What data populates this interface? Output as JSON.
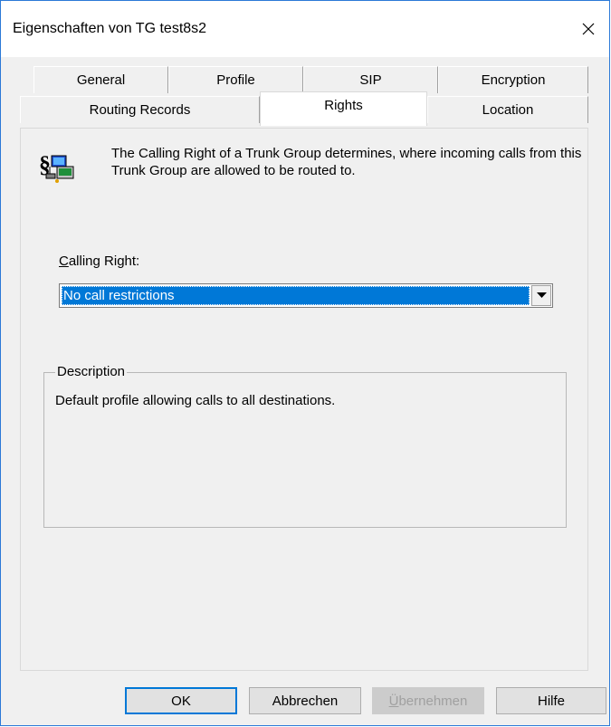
{
  "window": {
    "title": "Eigenschaften von TG test8s2",
    "close_glyph": "✕"
  },
  "tabs": {
    "row1": [
      "General",
      "Profile",
      "SIP",
      "Encryption"
    ],
    "row2": [
      "Routing Records",
      "Rights",
      "Location"
    ],
    "active": "Rights"
  },
  "rights": {
    "icon": "trunk-group-rights-icon",
    "info_text": "The Calling Right of a Trunk Group determines, where incoming calls from this Trunk Group are allowed to be routed to.",
    "calling_right_label_accel": "C",
    "calling_right_label_rest": "alling Right:",
    "calling_right_value": "No call restrictions",
    "description_title": "Description",
    "description_text": "Default profile allowing calls to all destinations."
  },
  "buttons": {
    "ok": "OK",
    "cancel": "Abbrechen",
    "apply_accel": "Ü",
    "apply_rest": "bernehmen",
    "help": "Hilfe"
  },
  "colors": {
    "selection": "#0078d7",
    "window_border": "#2b79d7",
    "dialog_bg": "#f0f0f0"
  }
}
